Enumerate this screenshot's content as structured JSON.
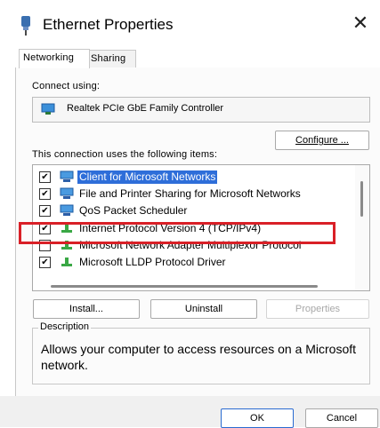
{
  "window": {
    "title": "Ethernet Properties",
    "close_symbol": "✕"
  },
  "tabs": [
    {
      "label": "Networking",
      "active": true
    },
    {
      "label": "Sharing",
      "active": false
    }
  ],
  "connect": {
    "label": "Connect using:",
    "adapter_name": "Realtek PCIe GbE Family Controller",
    "configure_label": "Configure ..."
  },
  "items_section": {
    "label": "This connection uses the following items:",
    "items": [
      {
        "label": "Client for Microsoft Networks",
        "checked": true,
        "selected": true,
        "icon": "network-client-icon"
      },
      {
        "label": "File and Printer Sharing for Microsoft Networks",
        "checked": true,
        "selected": false,
        "icon": "file-printer-sharing-icon"
      },
      {
        "label": "QoS Packet Scheduler",
        "checked": true,
        "selected": false,
        "icon": "qos-scheduler-icon"
      },
      {
        "label": "Internet Protocol Version 4 (TCP/IPv4)",
        "checked": true,
        "selected": false,
        "icon": "protocol-icon"
      },
      {
        "label": "Microsoft Network Adapter Multiplexor Protocol",
        "checked": false,
        "selected": false,
        "icon": "protocol-icon"
      },
      {
        "label": "Microsoft LLDP Protocol Driver",
        "checked": true,
        "selected": false,
        "icon": "protocol-icon"
      }
    ],
    "check_mark": "✔"
  },
  "actions": {
    "install": "Install...",
    "uninstall": "Uninstall",
    "properties": "Properties"
  },
  "description": {
    "legend": "Description",
    "text": "Allows your computer to access resources on a Microsoft network."
  },
  "footer": {
    "ok": "OK",
    "cancel": "Cancel"
  },
  "colors": {
    "selection": "#2e6ed9",
    "highlight_border": "#d92027",
    "protocol_icon": "#3aa845"
  }
}
